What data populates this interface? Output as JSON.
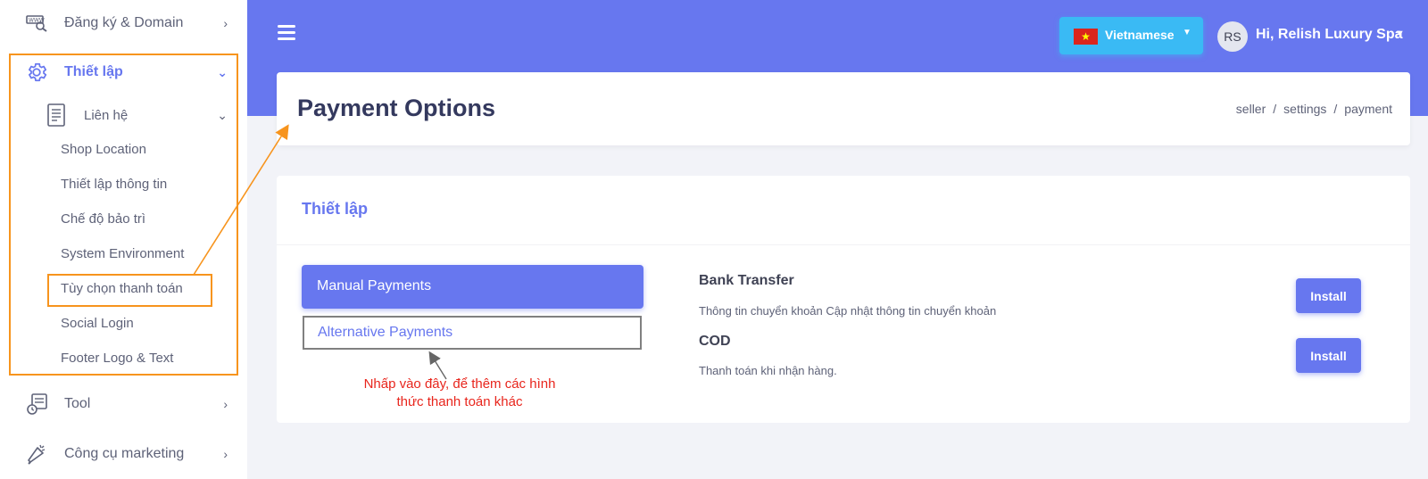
{
  "sidebar": {
    "items": [
      {
        "label": "Đăng ký & Domain",
        "icon": "domain-icon"
      },
      {
        "label": "Thiết lập",
        "icon": "gear-icon"
      },
      {
        "label": "Liên hệ",
        "icon": "document-icon"
      },
      {
        "label": "Tool",
        "icon": "tool-icon"
      },
      {
        "label": "Công cụ marketing",
        "icon": "marketing-icon"
      }
    ],
    "sub_items": [
      "Shop Location",
      "Thiết lập thông tin",
      "Chế độ bảo trì",
      "System Environment",
      "Tùy chọn thanh toán",
      "Social Login",
      "Footer Logo & Text"
    ]
  },
  "topbar": {
    "language": "Vietnamese",
    "avatar_initials": "RS",
    "user_greeting": "Hi, Relish Luxury Spa"
  },
  "header": {
    "title": "Payment Options",
    "breadcrumb": [
      "seller",
      "settings",
      "payment"
    ]
  },
  "card": {
    "title": "Thiết lập",
    "tabs": [
      "Manual Payments",
      "Alternative Payments"
    ],
    "methods": [
      {
        "name": "Bank Transfer",
        "description": "Thông tin chuyển khoản Cập nhật thông tin chuyển khoản",
        "button": "Install"
      },
      {
        "name": "COD",
        "description": "Thanh toán khi nhận hàng.",
        "button": "Install"
      }
    ]
  },
  "annotation": {
    "note_line1": "Nhấp vào đây, để thêm các hình",
    "note_line2": "thức thanh toán khác"
  },
  "colors": {
    "primary": "#6777ef",
    "info": "#3abaf4",
    "annotation_orange": "#f7941d",
    "annotation_red": "#e8251c"
  }
}
